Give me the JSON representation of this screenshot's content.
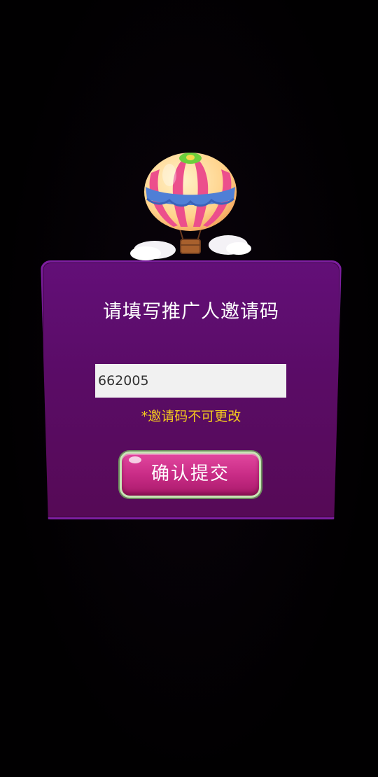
{
  "dialog": {
    "title": "请填写推广人邀请码",
    "invite_code_value": "662005",
    "hint": "*邀请码不可更改",
    "submit_label": "确认提交"
  },
  "colors": {
    "panel": "#5d0c6c",
    "panel_border": "#7d1ea0",
    "hint": "#f2c81e",
    "button": "#c92c86",
    "button_border": "#c9e6b7"
  },
  "icons": {
    "balloon": "hot-air-balloon-icon"
  }
}
